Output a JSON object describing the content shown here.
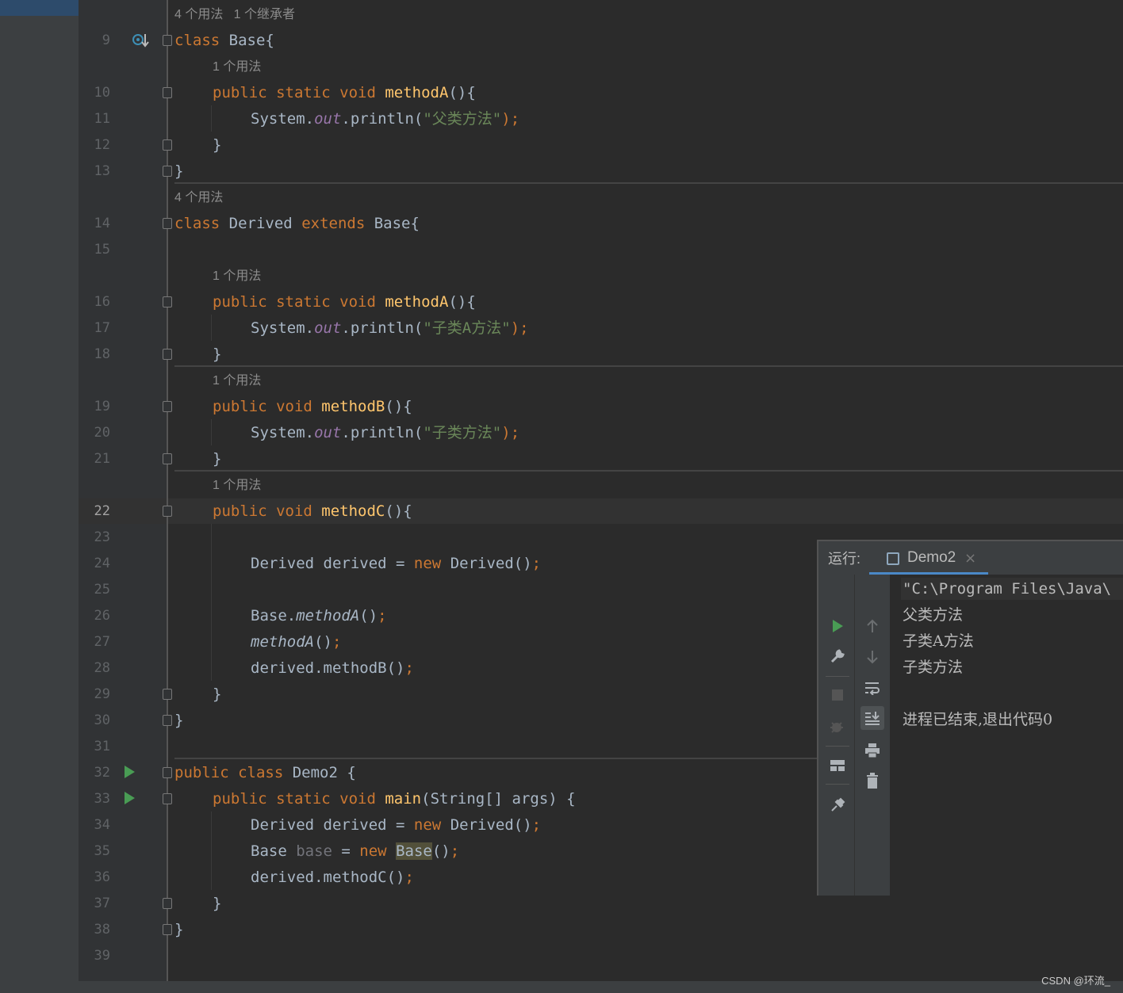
{
  "hints": {
    "h0": "4 个用法   1 个继承者",
    "h1": "1 个用法",
    "h2": "4 个用法",
    "h3": "1 个用法",
    "h4": "1 个用法",
    "h5": "1 个用法"
  },
  "line_numbers": [
    "9",
    "10",
    "11",
    "12",
    "13",
    "14",
    "15",
    "16",
    "17",
    "18",
    "19",
    "20",
    "21",
    "22",
    "23",
    "24",
    "25",
    "26",
    "27",
    "28",
    "29",
    "30",
    "31",
    "32",
    "33",
    "34",
    "35",
    "36",
    "37",
    "38",
    "39"
  ],
  "code": {
    "l9": [
      "class",
      "Base{"
    ],
    "l10": [
      "public static void",
      "methodA",
      "(){"
    ],
    "l11": [
      "System.",
      "out",
      ".println(",
      "\"父类方法\"",
      ");"
    ],
    "l12": [
      "}"
    ],
    "l13": [
      "}"
    ],
    "l14": [
      "class",
      "Derived",
      "extends",
      "Base{"
    ],
    "l16": [
      "public static void",
      "methodA",
      "(){"
    ],
    "l17": [
      "System.",
      "out",
      ".println(",
      "\"子类A方法\"",
      ");"
    ],
    "l18": [
      "}"
    ],
    "l19": [
      "public void",
      "methodB",
      "(){"
    ],
    "l20": [
      "System.",
      "out",
      ".println(",
      "\"子类方法\"",
      ");"
    ],
    "l21": [
      "}"
    ],
    "l22": [
      "public void",
      "methodC",
      "(){"
    ],
    "l24": [
      "Derived derived = ",
      "new",
      "Derived()",
      ";"
    ],
    "l26": [
      "Base.",
      "methodA",
      "()",
      ";"
    ],
    "l27": [
      "methodA",
      "()",
      ";"
    ],
    "l28": [
      "derived.methodB()",
      ";"
    ],
    "l29": [
      "}"
    ],
    "l30": [
      "}"
    ],
    "l32": [
      "public class",
      "Demo2 {"
    ],
    "l33": [
      "public static void",
      "main",
      "(String[] args) {"
    ],
    "l34": [
      "Derived derived = ",
      "new",
      "Derived()",
      ";"
    ],
    "l35": [
      "Base ",
      "base",
      " = ",
      "new",
      "Base",
      "()",
      ";"
    ],
    "l36": [
      "derived.methodC()",
      ";"
    ],
    "l37": [
      "}"
    ],
    "l38": [
      "}"
    ]
  },
  "run_panel": {
    "label": "运行:",
    "tab_name": "Demo2",
    "close_glyph": "×",
    "output": [
      "\"C:\\Program Files\\Java\\",
      "父类方法",
      "子类A方法",
      "子类方法",
      "",
      "进程已结束,退出代码0"
    ]
  },
  "watermark": "CSDN @环流_",
  "colors": {
    "keyword": "#cc7832",
    "function": "#ffc66d",
    "string": "#6a8759",
    "static_field": "#9876aa",
    "text": "#a9b7c6",
    "run_green": "#499c54"
  }
}
